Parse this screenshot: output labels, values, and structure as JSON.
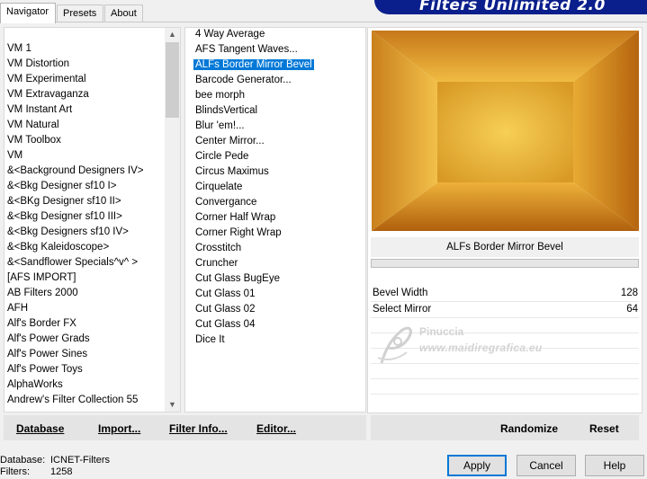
{
  "tabs": [
    {
      "label": "Navigator"
    },
    {
      "label": "Presets"
    },
    {
      "label": "About"
    }
  ],
  "banner": {
    "title": "Filters Unlimited 2.0"
  },
  "categories": [
    "VM 1",
    "VM Distortion",
    "VM Experimental",
    "VM Extravaganza",
    "VM Instant Art",
    "VM Natural",
    "VM Toolbox",
    "VM",
    "&<Background Designers IV>",
    "&<Bkg Designer sf10 I>",
    "&<BKg Designer sf10 II>",
    "&<Bkg Designer sf10 III>",
    "&<Bkg Designers sf10 IV>",
    "&<Bkg Kaleidoscope>",
    "&<Sandflower Specials^v^ >",
    "[AFS IMPORT]",
    "AB Filters 2000",
    "AFH",
    "Alf's Border FX",
    "Alf's Power Grads",
    "Alf's Power Sines",
    "Alf's Power Toys",
    "AlphaWorks",
    "Andrew's Filter Collection 55"
  ],
  "filters": [
    "4 Way Average",
    "AFS Tangent Waves...",
    "ALFs Border Mirror Bevel",
    "Barcode Generator...",
    "bee morph",
    "BlindsVertical",
    "Blur 'em!...",
    "Center Mirror...",
    "Circle Pede",
    "Circus Maximus",
    "Cirquelate",
    "Convergance",
    "Corner Half Wrap",
    "Corner Right Wrap",
    "Crosstitch",
    "Cruncher",
    "Cut Glass  BugEye",
    "Cut Glass 01",
    "Cut Glass 02",
    "Cut Glass 04",
    "Dice It"
  ],
  "selected_filter": "ALFs Border Mirror Bevel",
  "params": [
    {
      "name": "Bevel Width",
      "value": "128"
    },
    {
      "name": "Select Mirror",
      "value": "64"
    }
  ],
  "watermark": {
    "line1": "Pinuccia",
    "line2": "www.maidiregrafica.eu"
  },
  "left_buttons": {
    "database": "Database",
    "import": "Import...",
    "filter_info": "Filter Info...",
    "editor": "Editor..."
  },
  "right_buttons": {
    "randomize": "Randomize",
    "reset": "Reset"
  },
  "footer": {
    "database_label": "Database:",
    "database_value": "ICNET-Filters",
    "filters_label": "Filters:",
    "filters_value": "1258"
  },
  "dialog_buttons": {
    "apply": "Apply",
    "cancel": "Cancel",
    "help": "Help"
  },
  "colors": {
    "selection": "#0078d7",
    "banner": "#0a1f8c",
    "preview_light": "#f5c84a",
    "preview_dark": "#b5640e"
  }
}
